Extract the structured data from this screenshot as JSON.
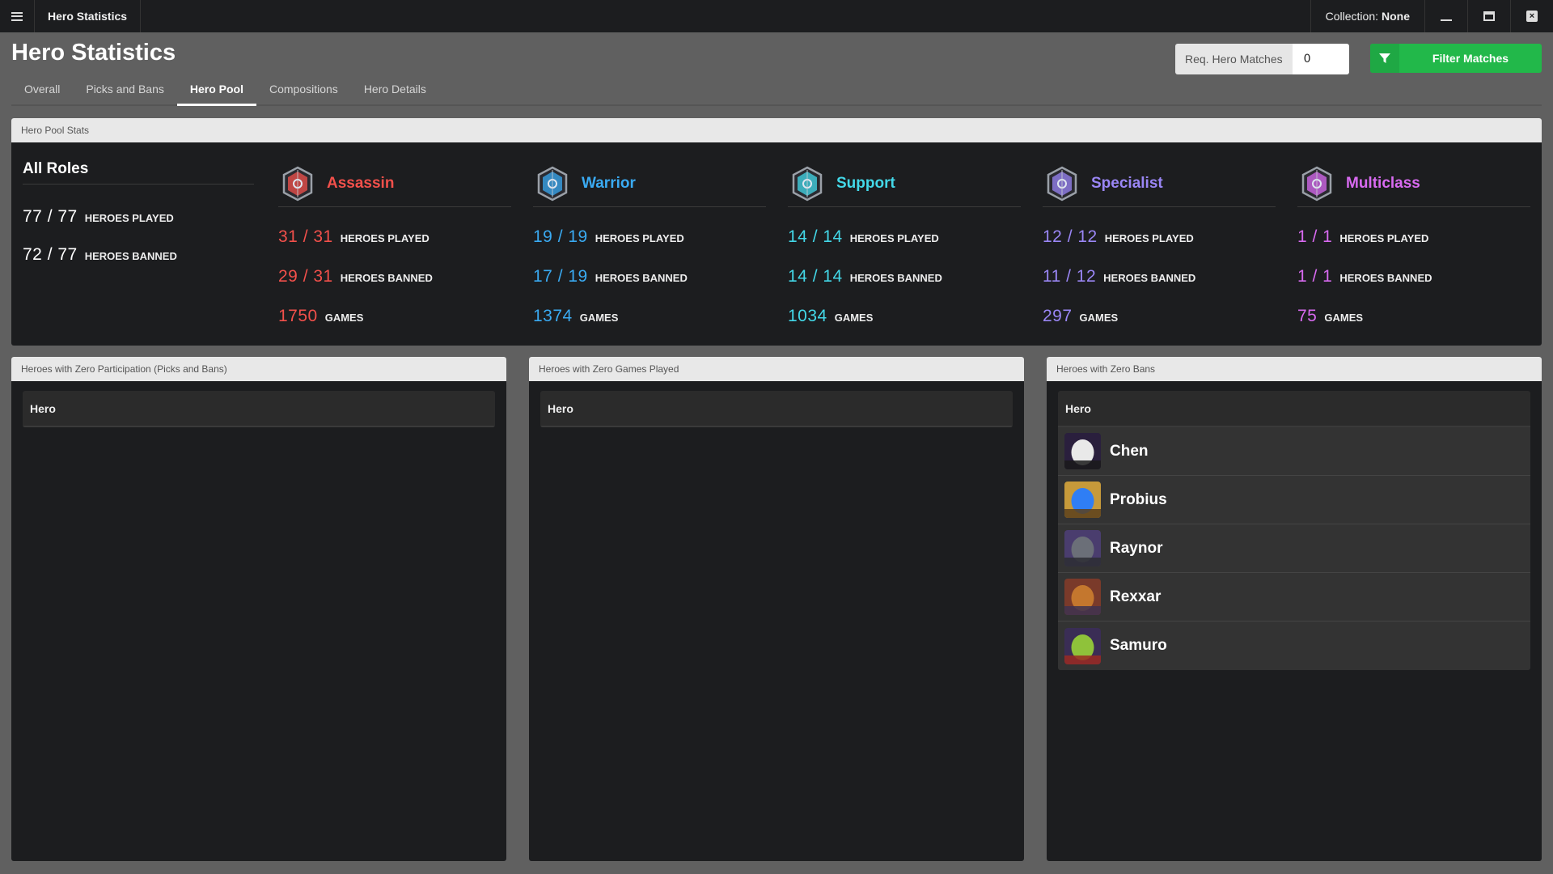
{
  "window": {
    "title": "Hero Statistics",
    "collection_label": "Collection:",
    "collection_value": "None",
    "close_glyph": "×"
  },
  "page": {
    "title": "Hero Statistics",
    "tabs": [
      {
        "label": "Overall",
        "active": false
      },
      {
        "label": "Picks and Bans",
        "active": false
      },
      {
        "label": "Hero Pool",
        "active": true
      },
      {
        "label": "Compositions",
        "active": false
      },
      {
        "label": "Hero Details",
        "active": false
      }
    ],
    "req_label": "Req. Hero Matches",
    "req_value": "0",
    "filter_label": "Filter Matches"
  },
  "stats": {
    "panel_title": "Hero Pool Stats",
    "all_roles": {
      "title": "All Roles",
      "played": "77 / 77",
      "played_label": "HEROES PLAYED",
      "banned": "72 / 77",
      "banned_label": "HEROES BANNED"
    },
    "roles": [
      {
        "name": "Assassin",
        "icon": "assassin-icon",
        "color": "#f2504b",
        "played": "31 / 31",
        "banned": "29 / 31",
        "games": "1750"
      },
      {
        "name": "Warrior",
        "icon": "warrior-icon",
        "color": "#3aaaf2",
        "played": "19 / 19",
        "banned": "17 / 19",
        "games": "1374"
      },
      {
        "name": "Support",
        "icon": "support-icon",
        "color": "#43d8e8",
        "played": "14 / 14",
        "banned": "14 / 14",
        "games": "1034"
      },
      {
        "name": "Specialist",
        "icon": "specialist-icon",
        "color": "#9a86f5",
        "played": "12 / 12",
        "banned": "11 / 12",
        "games": "297"
      },
      {
        "name": "Multiclass",
        "icon": "multiclass-icon",
        "color": "#d86af0",
        "played": "1 / 1",
        "banned": "1 / 1",
        "games": "75"
      }
    ],
    "played_label": "HEROES PLAYED",
    "banned_label": "HEROES BANNED",
    "games_label": "GAMES"
  },
  "lists": [
    {
      "title": "Heroes with Zero Participation (Picks and Bans)",
      "column": "Hero",
      "heroes": []
    },
    {
      "title": "Heroes with Zero Games Played",
      "column": "Hero",
      "heroes": []
    },
    {
      "title": "Heroes with Zero Bans",
      "column": "Hero",
      "heroes": [
        {
          "name": "Chen",
          "colors": [
            "#2a1f3d",
            "#e9e9e9",
            "#1a1a1a"
          ]
        },
        {
          "name": "Probius",
          "colors": [
            "#c79a3a",
            "#2f7ef5",
            "#5b3f1c"
          ]
        },
        {
          "name": "Raynor",
          "colors": [
            "#4a3d6e",
            "#6b6f78",
            "#2b2d33"
          ]
        },
        {
          "name": "Rexxar",
          "colors": [
            "#7a3a2a",
            "#c4772e",
            "#3e3350"
          ]
        },
        {
          "name": "Samuro",
          "colors": [
            "#3a2d55",
            "#8fc23a",
            "#9b2a22"
          ]
        }
      ]
    }
  ]
}
